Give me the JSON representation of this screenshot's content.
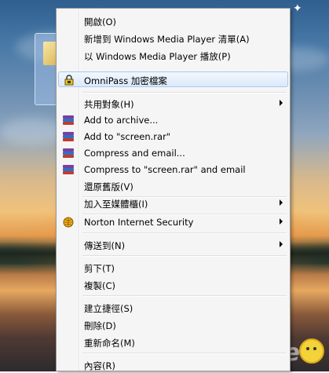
{
  "menu": {
    "items": [
      {
        "label": "開啟(O)"
      },
      {
        "label": "新增到 Windows Media Player 清單(A)"
      },
      {
        "label": "以 Windows Media Player 播放(P)"
      },
      {
        "label": "OmniPass 加密檔案",
        "icon": "lock-icon",
        "highlighted": true
      },
      {
        "label": "共用對象(H)",
        "submenu": true
      },
      {
        "label": "Add to archive...",
        "icon": "winrar-icon"
      },
      {
        "label": "Add to \"screen.rar\"",
        "icon": "winrar-icon"
      },
      {
        "label": "Compress and email...",
        "icon": "winrar-icon"
      },
      {
        "label": "Compress to \"screen.rar\" and email",
        "icon": "winrar-icon"
      },
      {
        "label": "還原舊版(V)"
      },
      {
        "label": "加入至媒體櫃(I)",
        "submenu": true
      },
      {
        "label": "Norton Internet Security",
        "icon": "norton-globe-icon",
        "submenu": true
      },
      {
        "label": "傳送到(N)",
        "submenu": true
      },
      {
        "label": "剪下(T)"
      },
      {
        "label": "複製(C)"
      },
      {
        "label": "建立捷徑(S)"
      },
      {
        "label": "刪除(D)"
      },
      {
        "label": "重新命名(M)"
      },
      {
        "label": "內容(R)"
      }
    ]
  },
  "watermark": {
    "text": "ePrice"
  },
  "colors": {
    "highlight_border": "#a8c8ee",
    "menu_bg": "#f5f5f5"
  }
}
